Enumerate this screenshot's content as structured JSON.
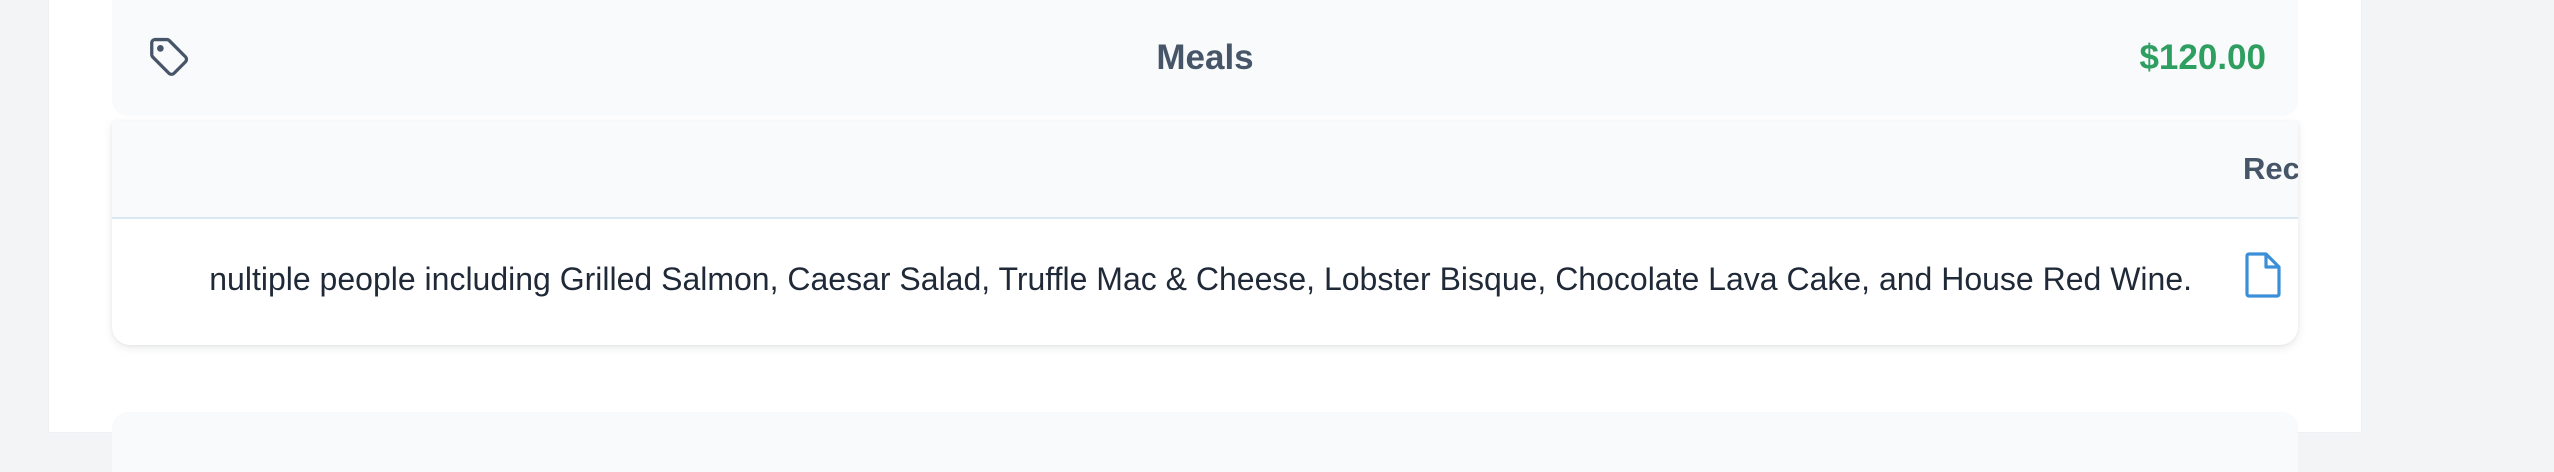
{
  "category": {
    "title": "Meals",
    "total": "$120.00",
    "icon": "tag-icon",
    "total_color": "#2f9e61"
  },
  "table": {
    "columns": [
      "Rec"
    ],
    "rows": [
      {
        "description": "nultiple people including Grilled Salmon, Caesar Salad, Truffle Mac & Cheese, Lobster Bisque, Chocolate Lava Cake, and House Red Wine.",
        "receipt_icon": "document-icon"
      }
    ]
  }
}
